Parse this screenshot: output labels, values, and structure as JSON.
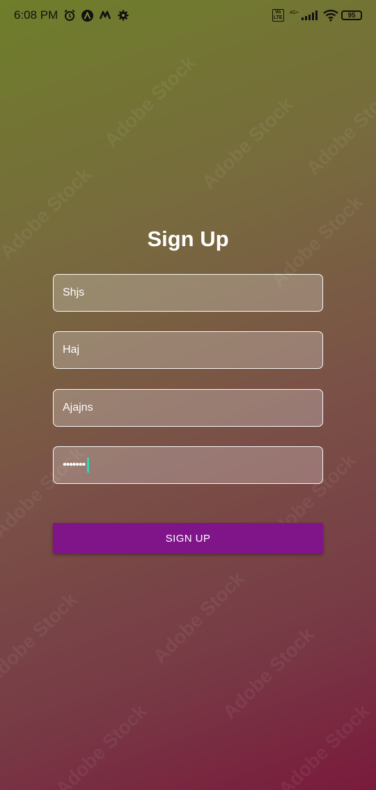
{
  "status_bar": {
    "time": "6:08 PM",
    "icons": [
      "alarm-icon",
      "app-a-icon",
      "app-m-icon",
      "settings-icon"
    ],
    "volte": "Vo\nLTE",
    "network": "4G+",
    "battery": "95"
  },
  "form": {
    "title": "Sign Up",
    "fields": [
      {
        "value": "Shjs"
      },
      {
        "value": "Haj"
      },
      {
        "value": "Ajajns"
      },
      {
        "value": "•••••••"
      }
    ],
    "submit_label": "SIGN UP"
  },
  "colors": {
    "button": "#80158a",
    "cursor": "#2fd6b8"
  }
}
